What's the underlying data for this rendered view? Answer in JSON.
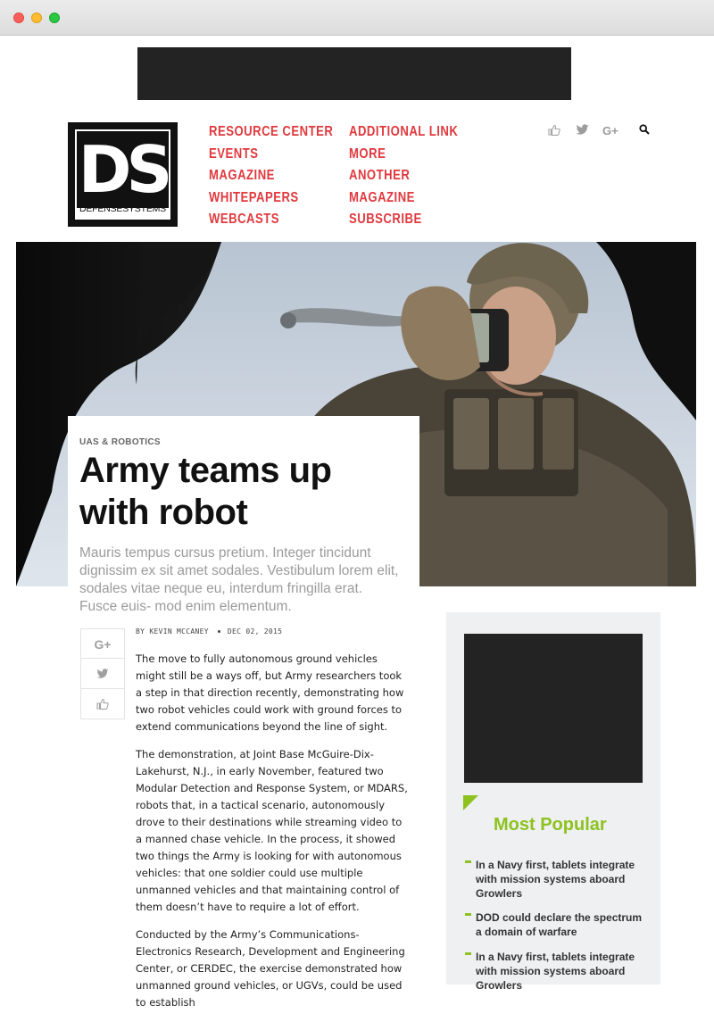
{
  "nav": {
    "col1": [
      "RESOURCE CENTER",
      "EVENTS",
      "MAGAZINE",
      "WHITEPAPERS",
      "WEBCASTS"
    ],
    "col2": [
      "ADDITIONAL LINK",
      "MORE",
      "ANOTHER",
      "MAGAZINE",
      "SUBSCRIBE"
    ]
  },
  "logo": {
    "mark": "DS",
    "wordmark": "DEFENSESYSTEMS"
  },
  "social_top": {
    "like": "👍",
    "twitter": "🐦",
    "gplus": "G+",
    "search": "⚲"
  },
  "article": {
    "kicker": "UAS & ROBOTICS",
    "headline": "Army teams up with robot",
    "dek": "Mauris tempus cursus pretium. Integer tincidunt dignissim ex sit amet sodales. Vestibulum lorem elit, sodales vitae neque eu, interdum fringilla erat. Fusce euis- mod enim elementum.",
    "author": "BY KEVIN MCCANEY",
    "date": "DEC 02, 2015",
    "paragraphs": [
      "The move to fully autonomous ground vehicles might still be a ways off, but Army researchers took a step in that direction recently, demonstrating how two robot vehicles could work with ground forces to extend communications beyond the line of sight.",
      "The demonstration, at Joint Base McGuire-Dix-Lakehurst, N.J., in early November, featured two Modular Detection and Response System, or MDARS, robots that, in a tactical scenario, autonomously drove to their destinations while streaming video to a manned chase vehicle. In the process, it showed two things the Army is looking for with autonomous vehicles: that one soldier could use multiple unmanned vehicles and that maintaining control of them doesn’t have to require a lot of effort.",
      "Conducted by the Army’s Communications-Electronics Research, Development and Engineering Center, or CERDEC, the exercise demonstrated how unmanned ground vehicles, or UGVs, could be used to establish"
    ]
  },
  "share": {
    "gplus": "G+",
    "twitter": "🐦",
    "like": "👍"
  },
  "sidebar": {
    "popular_title": "Most Popular",
    "items": [
      "In a Navy first, tablets integrate with mission systems aboard Growlers",
      "DOD could declare the spectrum a domain of warfare",
      "In a Navy first, tablets integrate with mission systems aboard Growlers"
    ]
  },
  "colors": {
    "nav": "#e0393e",
    "accent": "#8dc21f"
  }
}
